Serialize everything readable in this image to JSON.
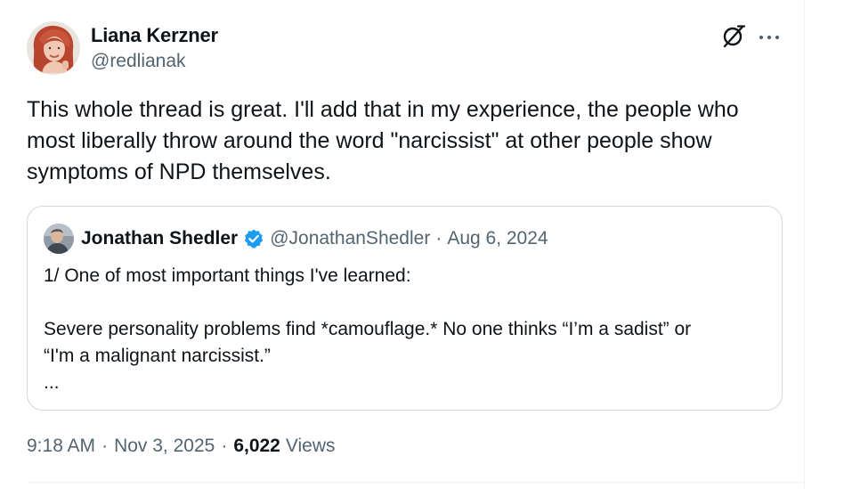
{
  "author": {
    "display_name": "Liana Kerzner",
    "handle": "@redlianak"
  },
  "header": {
    "icons": [
      "grok-icon",
      "more-icon"
    ]
  },
  "tweet": {
    "text": "This whole thread is great. I'll add that in my experience, the people who\nmost liberally throw around the word \"narcissist\" at other people show\nsymptoms of NPD themselves."
  },
  "quote": {
    "display_name": "Jonathan Shedler",
    "verified": true,
    "handle": "@JonathanShedler",
    "separator": "·",
    "date": "Aug 6, 2024",
    "line1": "1/ One of most important things I've learned:",
    "line2": "Severe personality problems find *camouflage.* No one thinks “I’m a sadist” or",
    "line3": "“I'm a malignant narcissist.”",
    "line4": "..."
  },
  "meta": {
    "time": "9:18 AM",
    "separator": "·",
    "date": "Nov 3, 2025",
    "views_count": "6,022",
    "views_label": "Views"
  },
  "colors": {
    "text": "#0f1419",
    "secondary": "#536471",
    "border": "#cfd9de",
    "verified": "#1d9bf0"
  }
}
